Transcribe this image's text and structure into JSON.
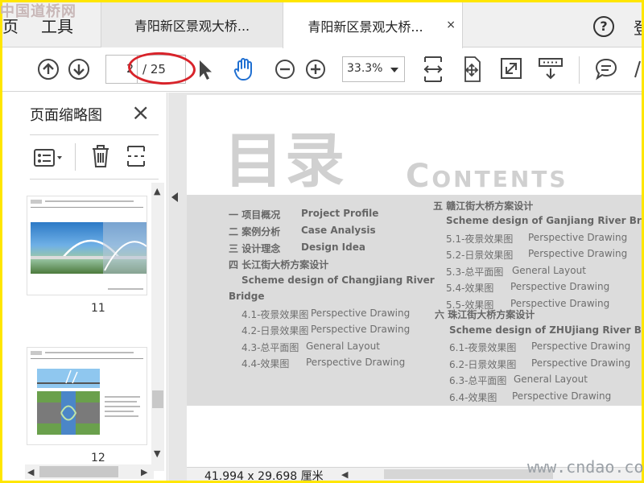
{
  "watermarks": {
    "cn": "中国道桥网",
    "en": "www.cndao.com"
  },
  "menu": {
    "home_fragment": "页",
    "tools": "工具",
    "login_fragment": "登"
  },
  "tabs": [
    {
      "label": "青阳新区景观大桥...",
      "active": false
    },
    {
      "label": "青阳新区景观大桥...",
      "active": true,
      "close": "×"
    }
  ],
  "toolbar": {
    "page_current": "2",
    "page_total": "/ 25",
    "zoom": "33.3%"
  },
  "left_panel": {
    "title": "页面缩略图",
    "close": "×",
    "thumbnails": [
      {
        "label": "11"
      },
      {
        "label": "12"
      }
    ]
  },
  "document": {
    "title_cn": "目录",
    "title_en": "Contents",
    "toc_left": [
      {
        "num": "一",
        "cn": "项目概况",
        "en": "Project Profile"
      },
      {
        "num": "二",
        "cn": "案例分析",
        "en": "Case Analysis"
      },
      {
        "num": "三",
        "cn": "设计理念",
        "en": "Design Idea"
      },
      {
        "num": "四",
        "cn": "长江街大桥方案设计",
        "en": ""
      },
      {
        "heading": "Scheme design of Changjiang River"
      },
      {
        "heading": "Bridge"
      },
      {
        "sub": "4.1-夜景效果图",
        "en": "Perspective  Drawing"
      },
      {
        "sub": "4.2-日景效果图",
        "en": "Perspective  Drawing"
      },
      {
        "sub": "4.3-总平面图",
        "en": "General Layout"
      },
      {
        "sub": "4.4-效果图",
        "en": "Perspective  Drawing"
      }
    ],
    "toc_right": [
      {
        "num": "五",
        "cn": "赣江街大桥方案设计"
      },
      {
        "heading": "Scheme design of Ganjiang River Bridge"
      },
      {
        "sub": "5.1-夜景效果图",
        "en": "Perspective  Drawing"
      },
      {
        "sub": "5.2-日景效果图",
        "en": "Perspective  Drawing"
      },
      {
        "sub": "5.3-总平面图",
        "en": "General Layout"
      },
      {
        "sub": "5.4-效果图",
        "en": "Perspective  Drawing"
      },
      {
        "sub": "5.5-效果图",
        "en": "Perspective  Drawing"
      },
      {
        "num": "六",
        "cn": "珠江街大桥方案设计"
      },
      {
        "heading": "Scheme design of ZHUjiang River Bridge"
      },
      {
        "sub": "6.1-夜景效果图",
        "en": "Perspective  Drawing"
      },
      {
        "sub": "6.2-日景效果图",
        "en": "Perspective  Drawing"
      },
      {
        "sub": "6.3-总平面图",
        "en": "General Layout"
      },
      {
        "sub": "6.4-效果图",
        "en": "Perspective  Drawing"
      }
    ]
  },
  "status": {
    "dimensions": "41.994 x 29.698 厘米"
  },
  "colors": {
    "highlight": "#ffe600",
    "annotation": "#d8232a",
    "hand_tool": "#1f6fd1"
  }
}
